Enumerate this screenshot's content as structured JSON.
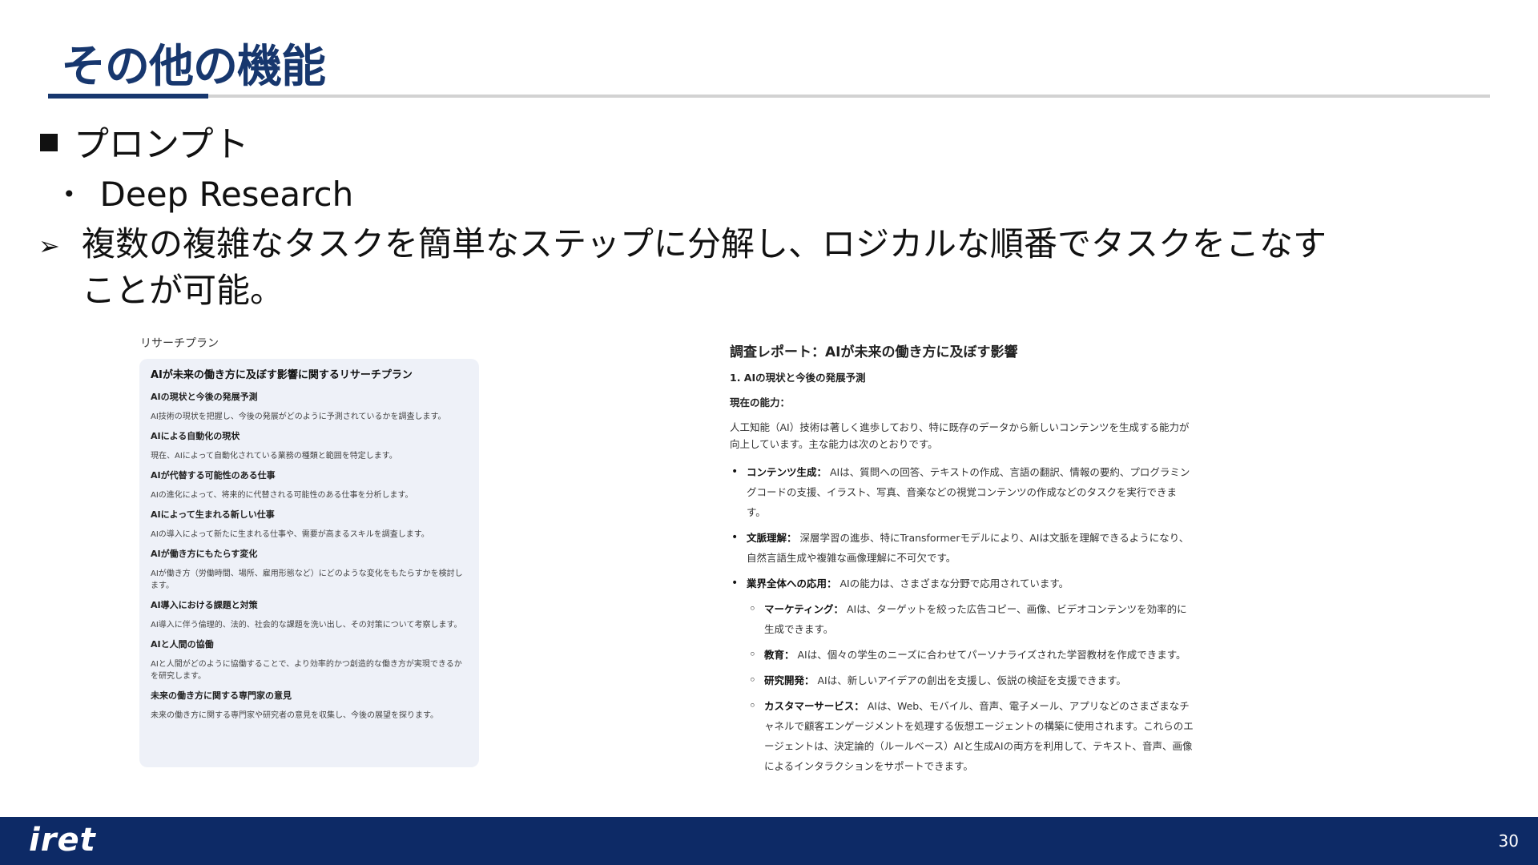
{
  "slide": {
    "title": "その他の機能",
    "bullet1": "プロンプト",
    "bullet2": "Deep Research",
    "bullet3": "複数の複雑なタスクを簡単なステップに分解し、ロジカルな順番でタスクをこなすことが可能。"
  },
  "plan": {
    "label": "リサーチプラン",
    "title": "AIが未来の働き方に及ぼす影響に関するリサーチプラン",
    "items": [
      {
        "head": "AIの現状と今後の発展予測",
        "desc": "AI技術の現状を把握し、今後の発展がどのように予測されているかを調査します。"
      },
      {
        "head": "AIによる自動化の現状",
        "desc": "現在、AIによって自動化されている業務の種類と範囲を特定します。"
      },
      {
        "head": "AIが代替する可能性のある仕事",
        "desc": "AIの進化によって、将来的に代替される可能性のある仕事を分析します。"
      },
      {
        "head": "AIによって生まれる新しい仕事",
        "desc": "AIの導入によって新たに生まれる仕事や、需要が高まるスキルを調査します。"
      },
      {
        "head": "AIが働き方にもたらす変化",
        "desc": "AIが働き方（労働時間、場所、雇用形態など）にどのような変化をもたらすかを検討します。"
      },
      {
        "head": "AI導入における課題と対策",
        "desc": "AI導入に伴う倫理的、法的、社会的な課題を洗い出し、その対策について考察します。"
      },
      {
        "head": "AIと人間の協働",
        "desc": "AIと人間がどのように協働することで、より効率的かつ創造的な働き方が実現できるかを研究します。"
      },
      {
        "head": "未来の働き方に関する専門家の意見",
        "desc": "未来の働き方に関する専門家や研究者の意見を収集し、今後の展望を探ります。"
      }
    ]
  },
  "report": {
    "title": "調査レポート：AIが未来の働き方に及ぼす影響",
    "section": "1. AIの現状と今後の発展予測",
    "subhead": "現在の能力：",
    "intro": "人工知能（AI）技術は著しく進歩しており、特に既存のデータから新しいコンテンツを生成する能力が向上しています。主な能力は次のとおりです。",
    "bullets": [
      {
        "lead": "コンテンツ生成：",
        "text": "AIは、質問への回答、テキストの作成、言語の翻訳、情報の要約、プログラミングコードの支援、イラスト、写真、音楽などの視覚コンテンツの作成などのタスクを実行できます。",
        "level": 1
      },
      {
        "lead": "文脈理解：",
        "text": "深層学習の進歩、特にTransformerモデルにより、AIは文脈を理解できるようになり、自然言語生成や複雑な画像理解に不可欠です。",
        "level": 1
      },
      {
        "lead": "業界全体への応用：",
        "text": "AIの能力は、さまざまな分野で応用されています。",
        "level": 1
      },
      {
        "lead": "マーケティング：",
        "text": "AIは、ターゲットを絞った広告コピー、画像、ビデオコンテンツを効率的に生成できます。",
        "level": 2
      },
      {
        "lead": "教育：",
        "text": "AIは、個々の学生のニーズに合わせてパーソナライズされた学習教材を作成できます。",
        "level": 2
      },
      {
        "lead": "研究開発：",
        "text": "AIは、新しいアイデアの創出を支援し、仮説の検証を支援できます。",
        "level": 2
      },
      {
        "lead": "カスタマーサービス：",
        "text": "AIは、Web、モバイル、音声、電子メール、アプリなどのさまざまなチャネルで顧客エンゲージメントを処理する仮想エージェントの構築に使用されます。これらのエージェントは、決定論的（ルールベース）AIと生成AIの両方を利用して、テキスト、音声、画像によるインタラクションをサポートできます。",
        "level": 2
      }
    ]
  },
  "footer": {
    "logo": "iret",
    "page_number": "30"
  },
  "colors": {
    "title": "#17376e",
    "footer_bg": "#0d2a66",
    "plan_card_bg": "#eef1f8"
  }
}
